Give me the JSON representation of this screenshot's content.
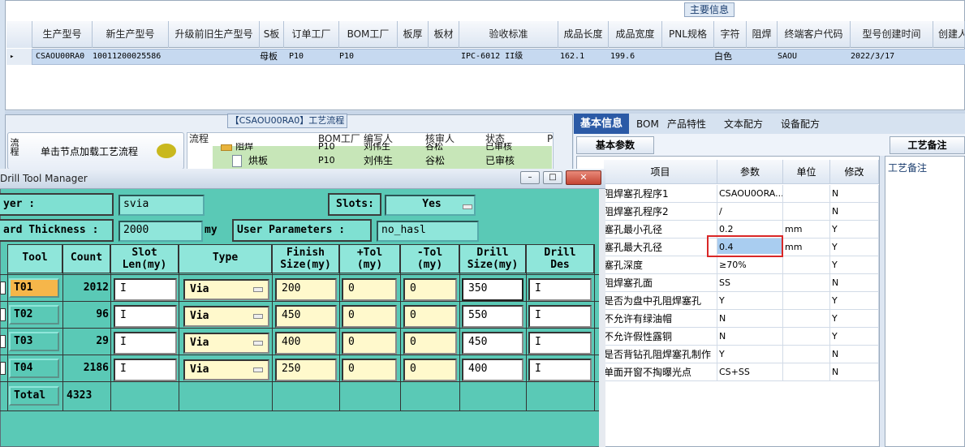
{
  "main_grid": {
    "title": "主要信息",
    "columns": [
      "生产型号",
      "新生产型号",
      "升级前旧生产型号",
      "S板",
      "订单工厂",
      "BOM工厂",
      "板厚",
      "板材",
      "验收标准",
      "成品长度",
      "成品宽度",
      "PNL规格",
      "字符",
      "阻焊",
      "终端客户代码",
      "型号创建时间",
      "创建人"
    ],
    "row": {
      "indicator": "▸",
      "生产型号": "CSAOU00RA0",
      "新生产型号": "10011200025586",
      "S板": "母板",
      "订单工厂": "P10",
      "BOM工厂": "P10",
      "验收标准": "IPC-6012 II级",
      "成品长度": "162.1",
      "成品宽度": "199.6",
      "阻焊": "白色",
      "终端客户代码": "SAOU",
      "型号创建时间": "2022/3/17"
    }
  },
  "process_panel": {
    "title": "【CSAOU00RA0】工艺流程",
    "load_button": "单击节点加载工艺流程",
    "side_label": "流程",
    "tree_headers": [
      "流程",
      "BOM工厂",
      "编写人",
      "核审人",
      "状态",
      "P"
    ],
    "tree_rows": [
      {
        "name": "阻焊",
        "factory": "P10",
        "writer": "刘伟生",
        "reviewer": "谷松",
        "status": "已审核"
      },
      {
        "name": "烘板",
        "factory": "P10",
        "writer": "刘伟生",
        "reviewer": "谷松",
        "status": "已审核"
      }
    ]
  },
  "right_panel": {
    "tabs": [
      "基本信息",
      "BOM",
      "产品特性",
      "文本配方",
      "设备配方"
    ],
    "subtab": "基本参数",
    "notes_tab": "工艺备注",
    "notes_label": "工艺备注",
    "param_headers": [
      "项目",
      "参数",
      "单位",
      "修改"
    ],
    "params": [
      {
        "item": "阻焊塞孔程序1",
        "value": "CSAOU0ORA...",
        "unit": "",
        "mod": "N"
      },
      {
        "item": "阻焊塞孔程序2",
        "value": "/",
        "unit": "",
        "mod": "N"
      },
      {
        "item": "塞孔最小孔径",
        "value": "0.2",
        "unit": "mm",
        "mod": "Y"
      },
      {
        "item": "塞孔最大孔径",
        "value": "0.4",
        "unit": "mm",
        "mod": "Y"
      },
      {
        "item": "塞孔深度",
        "value": "≥70%",
        "unit": "",
        "mod": "Y"
      },
      {
        "item": "阻焊塞孔面",
        "value": "SS",
        "unit": "",
        "mod": "N"
      },
      {
        "item": "是否为盘中孔阻焊塞孔",
        "value": "Y",
        "unit": "",
        "mod": "Y"
      },
      {
        "item": "不允许有绿油帽",
        "value": "N",
        "unit": "",
        "mod": "Y"
      },
      {
        "item": "不允许假性露铜",
        "value": "N",
        "unit": "",
        "mod": "Y"
      },
      {
        "item": "是否背钻孔阻焊塞孔制作",
        "value": "Y",
        "unit": "",
        "mod": "N"
      },
      {
        "item": "单面开窗不掏曝光点",
        "value": "CS+SS",
        "unit": "",
        "mod": "N"
      }
    ]
  },
  "drill_window": {
    "title": "Drill Tool Manager",
    "min": "–",
    "max": "□",
    "close": "✕",
    "layer_label": "yer            :",
    "layer_value": "svia",
    "slots_label": "Slots:",
    "slots_value": "Yes",
    "thickness_label": "ard Thickness  :",
    "thickness_value": "2000",
    "thickness_unit": "my",
    "user_params_label": "User Parameters :",
    "user_params_value": "no_hasl",
    "columns": [
      {
        "l1": "Tool",
        "l2": ""
      },
      {
        "l1": "Count",
        "l2": ""
      },
      {
        "l1": "Slot",
        "l2": "Len(my)"
      },
      {
        "l1": "Type",
        "l2": ""
      },
      {
        "l1": "Finish",
        "l2": "Size(my)"
      },
      {
        "l1": "+Tol",
        "l2": "(my)"
      },
      {
        "l1": "-Tol",
        "l2": "(my)"
      },
      {
        "l1": "Drill",
        "l2": "Size(my)"
      },
      {
        "l1": "Drill",
        "l2": "Des"
      }
    ],
    "rows": [
      {
        "tool": "T01",
        "count": "2012",
        "type": "Via",
        "finish": "200",
        "ptol": "0",
        "mtol": "0",
        "drill": "350"
      },
      {
        "tool": "T02",
        "count": "96",
        "type": "Via",
        "finish": "450",
        "ptol": "0",
        "mtol": "0",
        "drill": "550"
      },
      {
        "tool": "T03",
        "count": "29",
        "type": "Via",
        "finish": "400",
        "ptol": "0",
        "mtol": "0",
        "drill": "450"
      },
      {
        "tool": "T04",
        "count": "2186",
        "type": "Via",
        "finish": "250",
        "ptol": "0",
        "mtol": "0",
        "drill": "400"
      }
    ],
    "total_label": "Total",
    "total_count": "4323",
    "cursor_mark": "I"
  },
  "colors": {
    "teal": "#5ac9b6",
    "selected_tool": "#f6b64a",
    "highlight": "#d92727",
    "tab_active": "#2b5aa6"
  }
}
